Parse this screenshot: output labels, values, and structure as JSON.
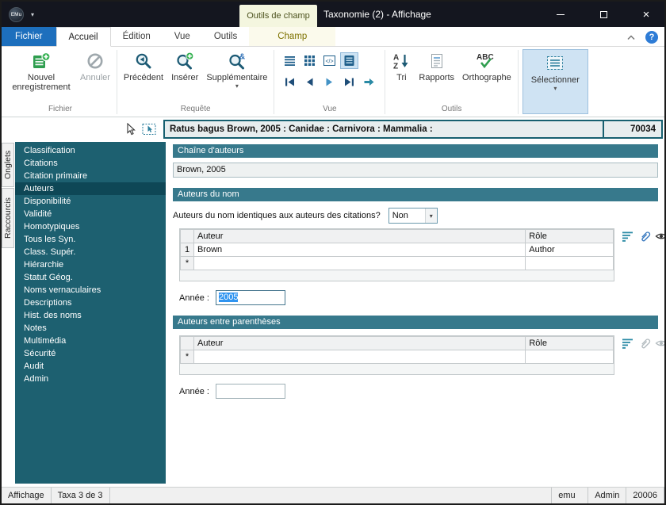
{
  "colors": {
    "titlebar_bg": "#14161f",
    "fichier_tab_blue": "#1d6fbd",
    "sidebar_teal": "#1d6070",
    "sidebar_selected": "#0e4756",
    "section_header_teal": "#37798c",
    "record_border_teal": "#176070",
    "selection_blue": "#2f94f0",
    "contextual_tab_bg": "#f4f6df"
  },
  "titlebar": {
    "logo": "EMu",
    "context_group": "Outils de champ",
    "title": "Taxonomie (2) - Affichage"
  },
  "tabs": {
    "fichier": "Fichier",
    "accueil": "Accueil",
    "edition": "Édition",
    "vue": "Vue",
    "outils": "Outils",
    "champ": "Champ"
  },
  "ribbon": {
    "new_record": "Nouvel enregistrement",
    "cancel": "Annuler",
    "previous": "Précédent",
    "insert": "Insérer",
    "additional": "Supplémentaire",
    "sort": "Tri",
    "reports": "Rapports",
    "spelling": "Orthographe",
    "select": "Sélectionner",
    "groups": {
      "fichier": "Fichier",
      "requete": "Requête",
      "vue": "Vue",
      "outils": "Outils"
    }
  },
  "record": {
    "summary": "Ratus bagus Brown, 2005 : Canidae : Carnivora : Mammalia :",
    "number": "70034"
  },
  "side_rail": {
    "onglets": "Onglets",
    "raccourcis": "Raccourcis"
  },
  "sidebar": {
    "items": [
      "Classification",
      "Citations",
      "Citation primaire",
      "Auteurs",
      "Disponibilité",
      "Validité",
      "Homotypiques",
      "Tous les Syn.",
      "Class. Supér.",
      "Hiérarchie",
      "Statut Géog.",
      "Noms vernaculaires",
      "Descriptions",
      "Hist. des noms",
      "Notes",
      "Multimédia",
      "Sécurité",
      "Audit",
      "Admin"
    ],
    "selected": "Auteurs"
  },
  "main": {
    "author_string": {
      "header": "Chaîne d'auteurs",
      "value": "Brown, 2005"
    },
    "name_authors": {
      "header": "Auteurs du nom",
      "question": "Auteurs du nom identiques aux auteurs des citations?",
      "answer": "Non",
      "columns": {
        "author": "Auteur",
        "role": "Rôle"
      },
      "rows": [
        {
          "num": "1",
          "author": "Brown",
          "role": "Author"
        }
      ],
      "new_row_marker": "*",
      "year_label": "Année :",
      "year": "2005"
    },
    "paren_authors": {
      "header": "Auteurs entre parenthèses",
      "columns": {
        "author": "Auteur",
        "role": "Rôle"
      },
      "new_row_marker": "*",
      "year_label": "Année :",
      "year": ""
    }
  },
  "statusbar": {
    "mode": "Affichage",
    "records": "Taxa 3 de 3",
    "service": "emu",
    "user": "Admin",
    "number": "20006"
  },
  "icons": {
    "caret_down": "▾",
    "close": "×",
    "help": "?"
  }
}
